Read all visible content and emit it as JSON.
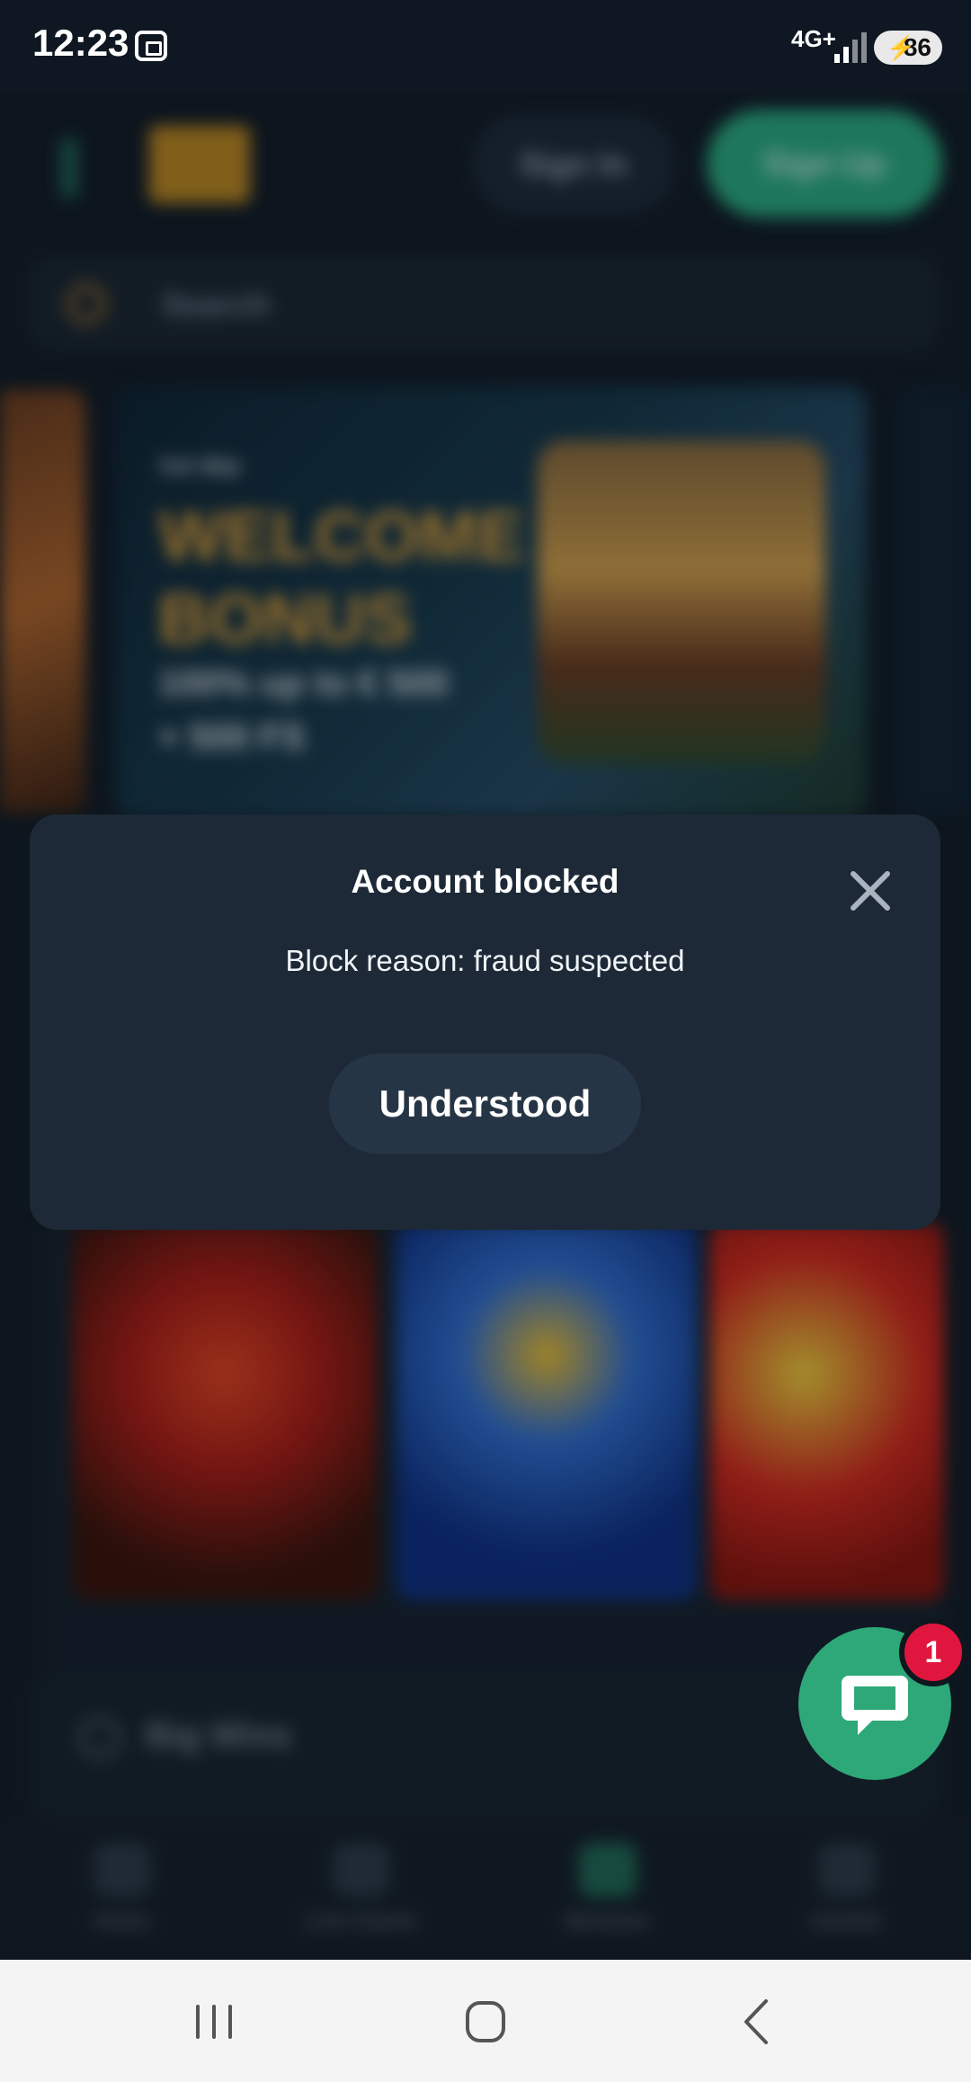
{
  "status_bar": {
    "time": "12:23",
    "network": "4G+",
    "battery": "86"
  },
  "header": {
    "signin_label": "Sign In",
    "signup_label": "Sign Up"
  },
  "search": {
    "placeholder": "Search"
  },
  "banner": {
    "tag": "1st dep",
    "title_line1": "WELCOME",
    "title_line2": "BONUS",
    "subtitle_line1": "100% up to € 500",
    "subtitle_line2": "+ 500 FS"
  },
  "big_wins": {
    "label": "Big Wins"
  },
  "bottom_nav": [
    "Home",
    "Live Casino",
    "Bonuses",
    "Cashier"
  ],
  "modal": {
    "title": "Account blocked",
    "message": "Block reason: fraud suspected",
    "button_label": "Understood"
  },
  "chat": {
    "badge_count": "1"
  },
  "colors": {
    "accent_green": "#2ea878",
    "modal_bg": "#1d2937",
    "badge_red": "#e0163e"
  }
}
